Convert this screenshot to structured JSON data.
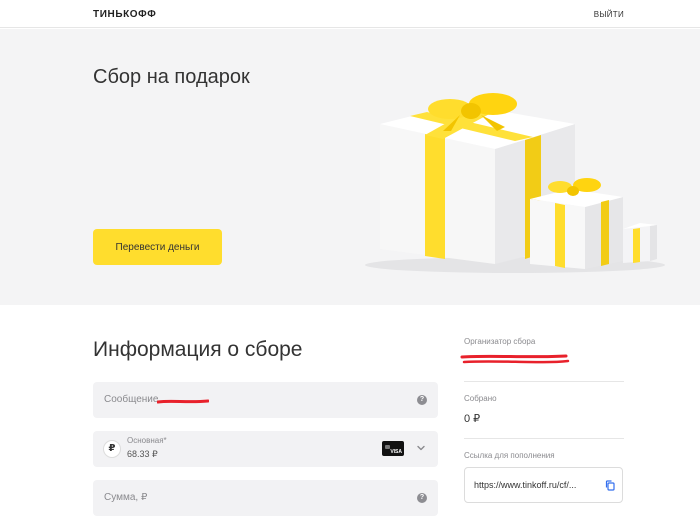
{
  "header": {
    "logo": "ТИНЬКОФФ",
    "logout": "ВЫЙТИ"
  },
  "hero": {
    "title": "Сбор на подарок",
    "transfer_button": "Перевести деньги"
  },
  "info": {
    "title": "Информация о сборе",
    "message_placeholder": "Сообщение",
    "account": {
      "currency_symbol": "₽",
      "name": "Основная*",
      "balance": "68.33 ₽",
      "card_brand": "VISA"
    },
    "amount_placeholder": "Сумма, ₽",
    "help_glyph": "?"
  },
  "sidebar": {
    "organizer_label": "Организатор сбора",
    "collected_label": "Собрано",
    "collected_value": "0 ₽",
    "link_label": "Ссылка для пополнения",
    "link_value": "https://www.tinkoff.ru/cf/..."
  },
  "colors": {
    "accent": "#ffdd2d",
    "hero_bg": "#f4f4f5",
    "field_bg": "#f2f2f4",
    "redaction": "#e8212b",
    "copy_icon": "#336fee"
  }
}
